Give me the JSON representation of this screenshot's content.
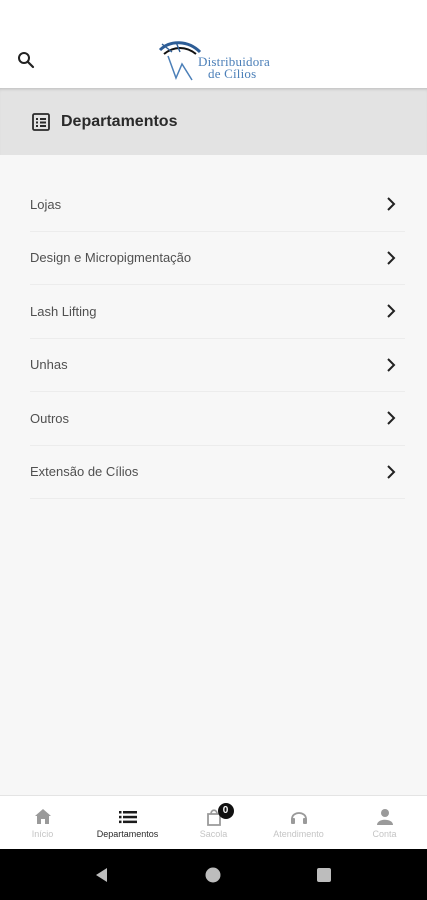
{
  "header": {
    "logo_line1": "Distribuidora",
    "logo_line2": "de Cílios",
    "search_icon": "search-icon",
    "accent_color": "#4b7fb8"
  },
  "section": {
    "icon": "list-box-icon",
    "title": "Departamentos"
  },
  "departments": [
    {
      "label": "Lojas"
    },
    {
      "label": "Design e Micropigmentação"
    },
    {
      "label": "Lash Lifting"
    },
    {
      "label": "Unhas"
    },
    {
      "label": "Outros"
    },
    {
      "label": "Extensão de Cílios"
    }
  ],
  "bottom_nav": {
    "items": [
      {
        "label": "Início",
        "icon": "home-icon"
      },
      {
        "label": "Departamentos",
        "icon": "list-icon",
        "active": true
      },
      {
        "label": "Sacola",
        "icon": "bag-icon",
        "badge": "0"
      },
      {
        "label": "Atendimento",
        "icon": "headset-icon"
      },
      {
        "label": "Conta",
        "icon": "user-icon"
      }
    ]
  },
  "system_nav": [
    "back-icon",
    "home-circle-icon",
    "recents-icon"
  ]
}
